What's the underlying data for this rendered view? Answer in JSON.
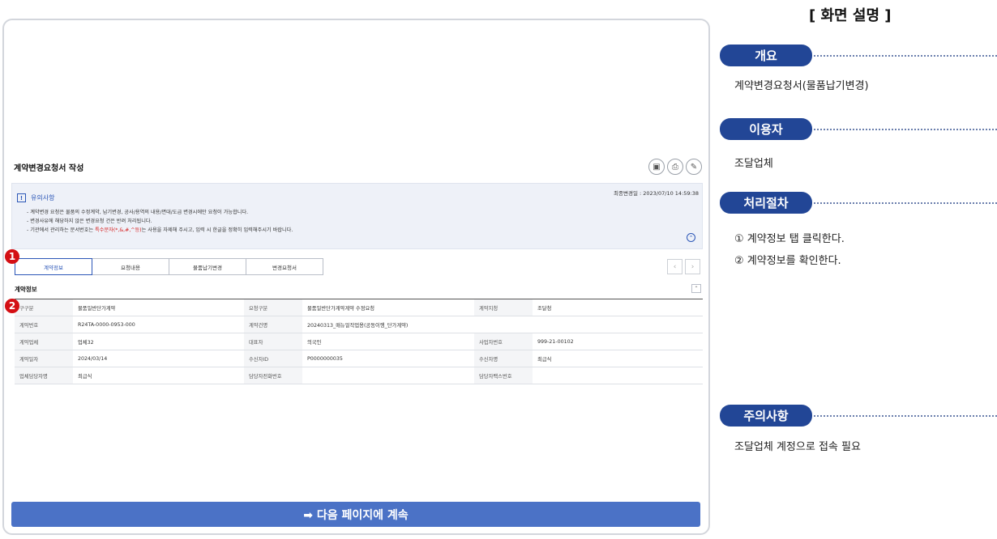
{
  "screen": {
    "page_title": "계약변경요청서 작성",
    "tool_icons": [
      "save-icon",
      "print-icon",
      "settings-icon"
    ],
    "notice": {
      "title": "유의사항",
      "last_updated": "최종변경일 : 2023/07/10 14:59:38",
      "line1": "- 계약변경 요청은 물품의 수정계약, 납기변경, 공사/용역의 내용/면대/도급 변경시에만 요청이 가능합니다.",
      "line2": "- 변경사유에 해당하지 않은 변경요청 건은 반려 처리됩니다.",
      "line3_a": "- 기관에서 관리하는 문서번호는 ",
      "line3_red": "특수문자(*,&,#,^등)",
      "line3_b": "는 사용을 자제해 주시고, 입력 시 한글을 정확히 입력해주시기 바랍니다."
    },
    "tabs": [
      "계약정보",
      "요청내용",
      "물품납기변경",
      "변경요청서"
    ],
    "markers": [
      "1",
      "2"
    ],
    "section_title": "계약정보",
    "table": [
      [
        "구구분",
        "물품일반단가계약",
        "요청구분",
        "물품일반단가계약계약 수정요청",
        "계약지청",
        "조달청"
      ],
      [
        "계약번호",
        "R24TA-0000-0953-000",
        "계약건명",
        "20240313_매뉴얼작업용(공동이행_단가계약)",
        "",
        ""
      ],
      [
        "계약업체",
        "업체32",
        "대표자",
        "의국인",
        "사업자번호",
        "999-21-00102"
      ],
      [
        "계약일자",
        "2024/03/14",
        "수신자ID",
        "P0000000035",
        "수신자명",
        "최급식"
      ],
      [
        "업체담당자명",
        "최급식",
        "담당자전화번호",
        "",
        "담당자팩스번호",
        ""
      ]
    ],
    "next_button": "➡ 다음 페이지에 계속"
  },
  "panel": {
    "heading": "[ 화면 설명 ]",
    "overview_label": "개요",
    "overview_text": "계약변경요청서(물품납기변경)",
    "user_label": "이용자",
    "user_text": "조달업체",
    "procedure_label": "처리절차",
    "step1": "① 계약정보 탭 클릭한다.",
    "step2": "② 계약정보를 확인한다.",
    "caution_label": "주의사항",
    "caution_text": "조달업체 계정으로 접속 필요"
  }
}
